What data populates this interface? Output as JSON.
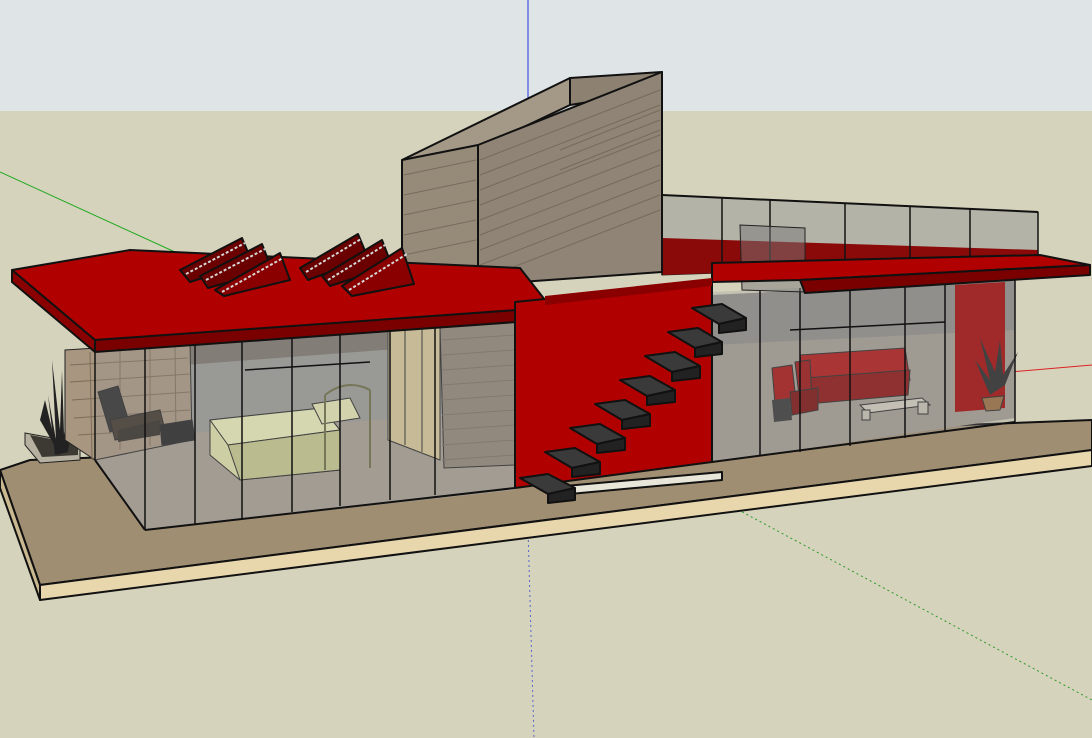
{
  "colors": {
    "sky": "#dfe4e6",
    "ground": "#d6d3bd",
    "deck_top": "#a08e72",
    "deck_edge": "#e8d6ad",
    "roof_red": "#b00000",
    "roof_dark": "#7a0000",
    "brick": "#8f8475",
    "glass": "#8c8c8c",
    "stair": "#3a3a3a",
    "bed": "#e2e3a8",
    "sofa": "#b01010",
    "axis_blue": "#2233dd",
    "axis_green": "#22aa22",
    "axis_red": "#dd2222"
  },
  "scene": {
    "model": "modern-house-with-red-roof",
    "objects": [
      "ground-plane",
      "wooden-deck",
      "glass-walls",
      "red-roof",
      "solar-panels",
      "brick-chimney",
      "red-stair-wall",
      "floating-stairs",
      "roof-terrace-railing",
      "bedroom",
      "bed",
      "armchair",
      "fireplace-stone-wall",
      "living-room",
      "red-sofa",
      "red-armchairs",
      "coffee-table",
      "potted-plant",
      "plant-planter"
    ]
  }
}
